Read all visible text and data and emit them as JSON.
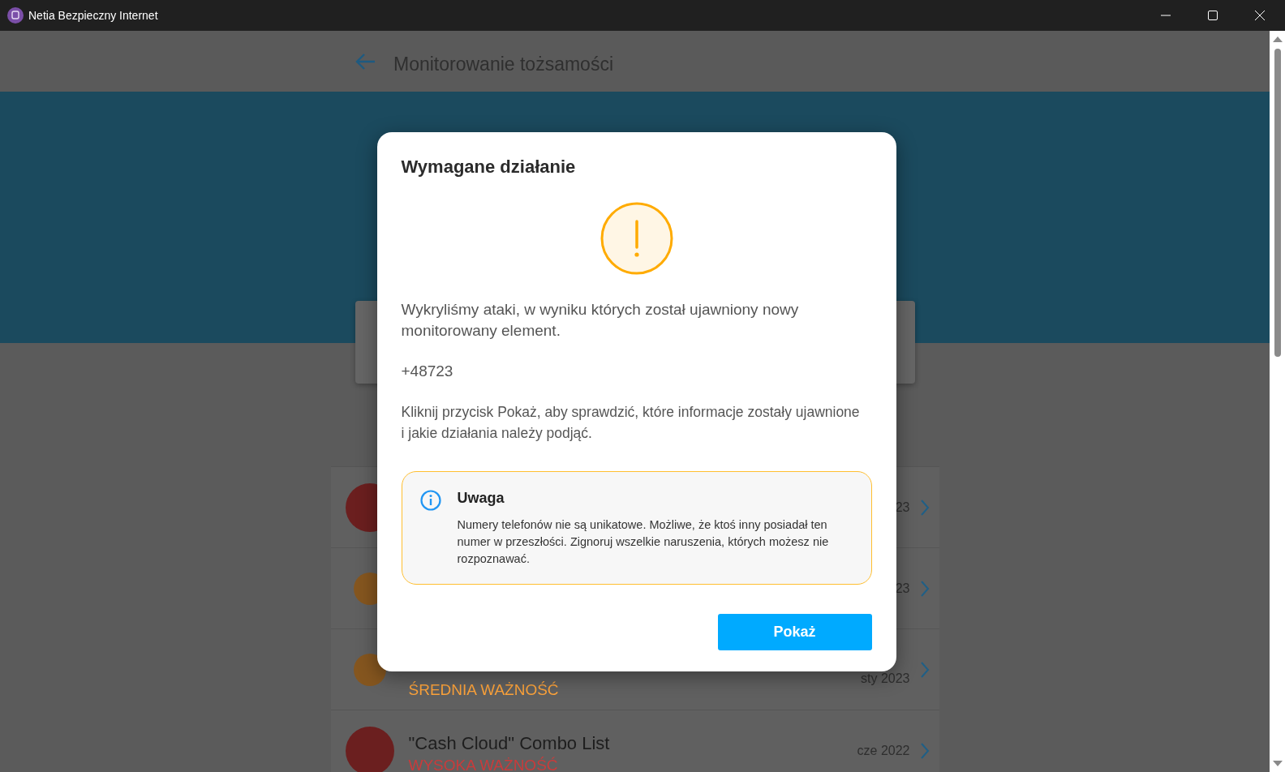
{
  "window": {
    "title": "Netia Bezpieczny Internet"
  },
  "header": {
    "title": "Monitorowanie tożsamości"
  },
  "breaches": [
    {
      "color": "#6b1f1f",
      "date": "23"
    },
    {
      "color": "#85561f",
      "date": "23"
    },
    {
      "color": "#85561f",
      "severity": "ŚREDNIA WAŻNOŚĆ",
      "date": "sty 2023"
    },
    {
      "color": "#6b1f1f",
      "title": "\"Cash Cloud\" Combo List",
      "severity": "WYSOKA WAŻNOŚĆ",
      "date": "cze 2022"
    }
  ],
  "dialog": {
    "title": "Wymagane działanie",
    "message": "Wykryliśmy ataki, w wyniku których został ujawniony nowy monitorowany element.",
    "item": "+48723",
    "instruction": "Kliknij przycisk Pokaż, aby sprawdzić, które informacje zostały ujawnione i jakie działania należy podjąć.",
    "note": {
      "title": "Uwaga",
      "text": "Numery telefonów nie są unikatowe. Możliwe, że ktoś inny posiadał ten numer w przeszłości. Zignoruj wszelkie naruszenia, których możesz nie rozpoznawać."
    },
    "button": "Pokaż"
  }
}
